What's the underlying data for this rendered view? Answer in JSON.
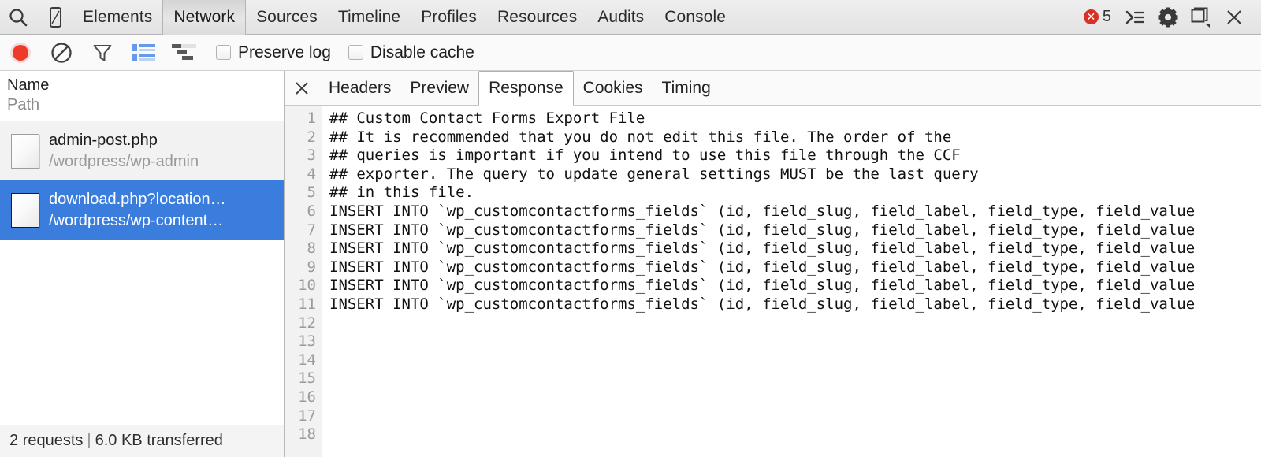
{
  "window": {
    "tabs": [
      {
        "label": "Elements",
        "active": false
      },
      {
        "label": "Network",
        "active": true
      },
      {
        "label": "Sources",
        "active": false
      },
      {
        "label": "Timeline",
        "active": false
      },
      {
        "label": "Profiles",
        "active": false
      },
      {
        "label": "Resources",
        "active": false
      },
      {
        "label": "Audits",
        "active": false
      },
      {
        "label": "Console",
        "active": false
      }
    ],
    "search_icon": "search-icon",
    "device_icon": "device-toolbar-icon",
    "error_count": "5",
    "error_icon": "error-circle-icon",
    "drawer_icon": "console-drawer-icon",
    "settings_icon": "gear-icon",
    "dock_icon": "dock-position-icon",
    "close_icon": "close-icon"
  },
  "toolbar": {
    "record_icon": "record-button-icon",
    "clear_icon": "clear-icon",
    "filter_icon": "filter-icon",
    "list_view_icon": "list-view-icon",
    "waterfall_icon": "waterfall-view-icon",
    "preserve_log_label": "Preserve log",
    "preserve_log_checked": false,
    "disable_cache_label": "Disable cache",
    "disable_cache_checked": false
  },
  "requests_panel": {
    "header": {
      "name_label": "Name",
      "path_label": "Path"
    },
    "rows": [
      {
        "name": "admin-post.php",
        "path": "/wordpress/wp-admin",
        "selected": false,
        "icon": "document-icon"
      },
      {
        "name": "download.php?location…",
        "path": "/wordpress/wp-content…",
        "selected": true,
        "icon": "document-icon"
      }
    ],
    "status": {
      "requests": "2 requests",
      "separator": "|",
      "transferred": "6.0 KB transferred"
    }
  },
  "detail_panel": {
    "close_icon": "close-icon",
    "tabs": [
      {
        "label": "Headers",
        "active": false
      },
      {
        "label": "Preview",
        "active": false
      },
      {
        "label": "Response",
        "active": true
      },
      {
        "label": "Cookies",
        "active": false
      },
      {
        "label": "Timing",
        "active": false
      }
    ],
    "response": {
      "lines": [
        {
          "n": "1",
          "text": "## Custom Contact Forms Export File"
        },
        {
          "n": "2",
          "text": "## It is recommended that you do not edit this file. The order of the"
        },
        {
          "n": "3",
          "text": "## queries is important if you intend to use this file through the CCF"
        },
        {
          "n": "4",
          "text": "## exporter. The query to update general settings MUST be the last query"
        },
        {
          "n": "5",
          "text": "## in this file."
        },
        {
          "n": "6",
          "text": ""
        },
        {
          "n": "7",
          "text": "INSERT INTO `wp_customcontactforms_fields` (id, field_slug, field_label, field_type, field_value"
        },
        {
          "n": "8",
          "text": ""
        },
        {
          "n": "9",
          "text": "INSERT INTO `wp_customcontactforms_fields` (id, field_slug, field_label, field_type, field_value"
        },
        {
          "n": "10",
          "text": ""
        },
        {
          "n": "11",
          "text": "INSERT INTO `wp_customcontactforms_fields` (id, field_slug, field_label, field_type, field_value"
        },
        {
          "n": "12",
          "text": ""
        },
        {
          "n": "13",
          "text": "INSERT INTO `wp_customcontactforms_fields` (id, field_slug, field_label, field_type, field_value"
        },
        {
          "n": "14",
          "text": ""
        },
        {
          "n": "15",
          "text": "INSERT INTO `wp_customcontactforms_fields` (id, field_slug, field_label, field_type, field_value"
        },
        {
          "n": "16",
          "text": ""
        },
        {
          "n": "17",
          "text": "INSERT INTO `wp_customcontactforms_fields` (id, field_slug, field_label, field_type, field_value"
        },
        {
          "n": "18",
          "text": ""
        }
      ]
    }
  },
  "colors": {
    "selection_blue": "#3b7ddd",
    "error_red": "#d93025",
    "active_icon_blue": "#4a84e0",
    "toolbar_bg": "#fafafa",
    "tabbar_bg": "#e6e6e6"
  }
}
